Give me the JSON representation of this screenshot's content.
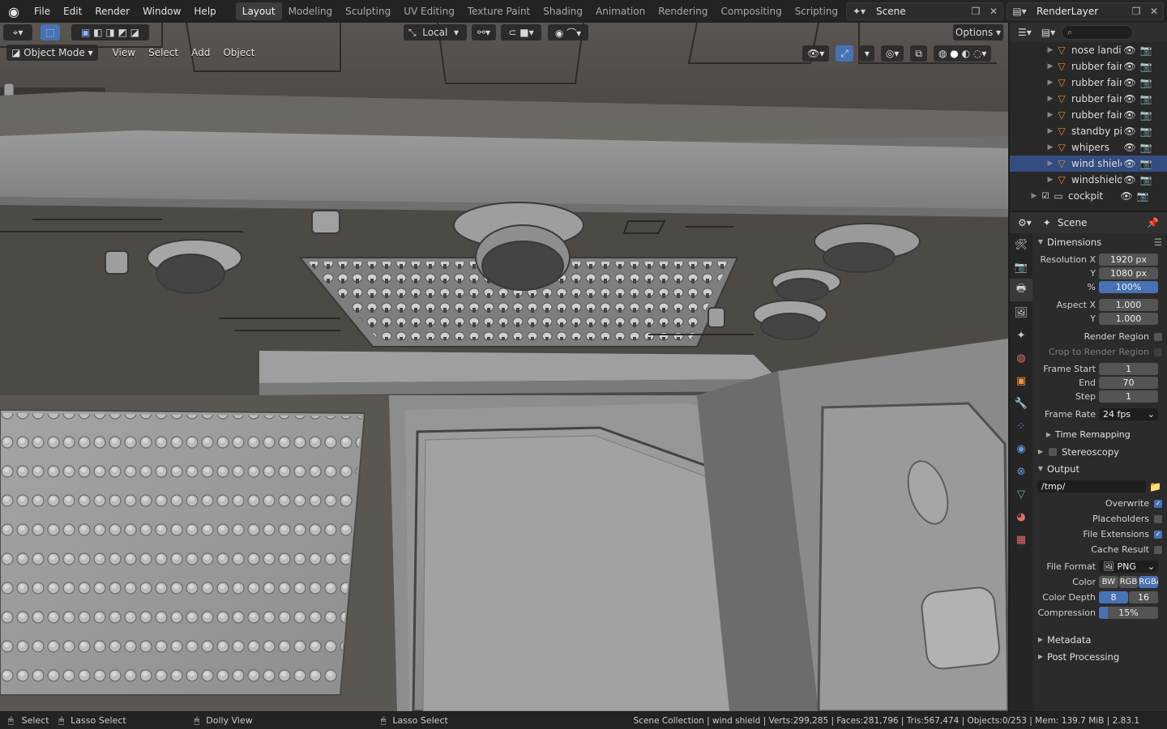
{
  "menu": [
    "File",
    "Edit",
    "Render",
    "Window",
    "Help"
  ],
  "workspaces": [
    "Layout",
    "Modeling",
    "Sculpting",
    "UV Editing",
    "Texture Paint",
    "Shading",
    "Animation",
    "Rendering",
    "Compositing",
    "Scripting"
  ],
  "scene_name": "Scene",
  "view_layer": "RenderLayer",
  "viewport": {
    "transform_orientation": "Local",
    "options_label": "Options",
    "mode": "Object Mode",
    "menus": [
      "View",
      "Select",
      "Add",
      "Object"
    ]
  },
  "outliner": {
    "rows": [
      {
        "name": "nose landing",
        "selected": false
      },
      {
        "name": "rubber fairin",
        "selected": false
      },
      {
        "name": "rubber fairin",
        "selected": false
      },
      {
        "name": "rubber fairin",
        "selected": false
      },
      {
        "name": "rubber fairin",
        "selected": false
      },
      {
        "name": "standby pitit",
        "selected": false
      },
      {
        "name": "whipers",
        "selected": false
      },
      {
        "name": "wind shield",
        "selected": true
      },
      {
        "name": "windshield c",
        "selected": false
      },
      {
        "name": "cockpit",
        "selected": false
      }
    ]
  },
  "properties": {
    "context": "Scene",
    "dimensions": {
      "title": "Dimensions",
      "resolution_x_label": "Resolution X",
      "resolution_x": "1920 px",
      "y_label": "Y",
      "resolution_y": "1080 px",
      "percent_label": "%",
      "percent": "100%",
      "aspect_x_label": "Aspect X",
      "aspect_x": "1.000",
      "aspect_y": "1.000",
      "render_region": "Render Region",
      "crop_region": "Crop to Render Region",
      "frame_start_label": "Frame Start",
      "frame_start": "1",
      "end_label": "End",
      "frame_end": "70",
      "step_label": "Step",
      "frame_step": "1",
      "frame_rate_label": "Frame Rate",
      "frame_rate": "24 fps",
      "time_remapping": "Time Remapping"
    },
    "stereoscopy": "Stereoscopy",
    "output": {
      "title": "Output",
      "path": "/tmp/",
      "overwrite": "Overwrite",
      "placeholders": "Placeholders",
      "file_extensions": "File Extensions",
      "cache_result": "Cache Result",
      "file_format_label": "File Format",
      "file_format": "PNG",
      "color_label": "Color",
      "color_modes": [
        "BW",
        "RGB",
        "RGBA"
      ],
      "color_depth_label": "Color Depth",
      "color_depths": [
        "8",
        "16"
      ],
      "compression_label": "Compression",
      "compression": "15%"
    },
    "metadata": "Metadata",
    "post_processing": "Post Processing"
  },
  "statusbar": {
    "select": "Select",
    "lasso_select": "Lasso Select",
    "dolly_view": "Dolly View",
    "lasso_select_2": "Lasso Select",
    "stats": "Scene Collection | wind shield | Verts:299,285 | Faces:281,796 | Tris:567,474 | Objects:0/253 | Mem: 139.7 MiB | 2.83.1"
  },
  "colors": {
    "accent": "#4772b3",
    "mesh_icon": "#e38b3c",
    "selection_row": "#334d80"
  }
}
